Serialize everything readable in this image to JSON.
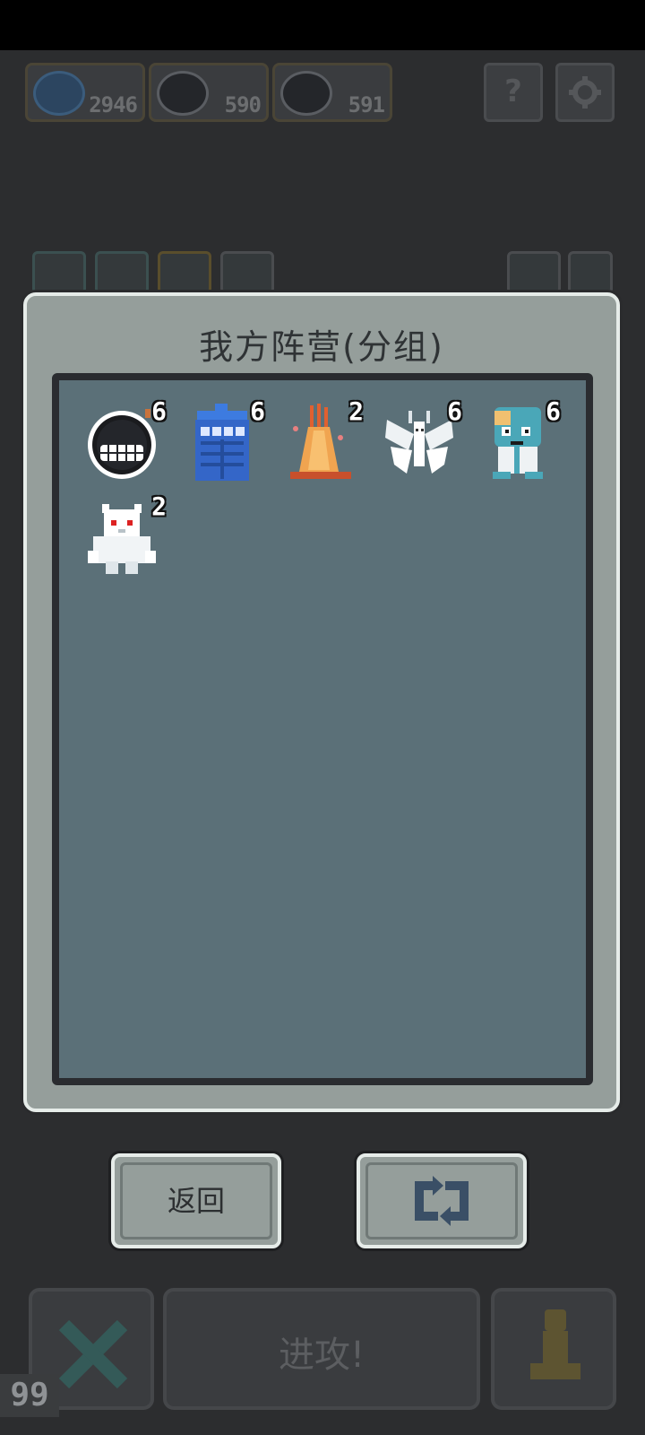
{
  "resources": [
    {
      "icon": "blue-gem-icon",
      "value": "2946"
    },
    {
      "icon": "grinning-bomb-icon",
      "value": "590"
    },
    {
      "icon": "grinning-bomb-icon",
      "value": "591"
    }
  ],
  "top_buttons": {
    "help_label": "?",
    "settings_icon": "gear-icon"
  },
  "dialog": {
    "title": "我方阵营(分组)",
    "units": [
      {
        "name": "grinning-bomb",
        "count": "6"
      },
      {
        "name": "blue-booth",
        "count": "6"
      },
      {
        "name": "flame-tree",
        "count": "2"
      },
      {
        "name": "white-moth",
        "count": "6"
      },
      {
        "name": "teal-frog-creature",
        "count": "6"
      },
      {
        "name": "white-yeti",
        "count": "2"
      }
    ],
    "back_label": "返回",
    "swap_icon": "swap-arrows-icon"
  },
  "bottom_bar": {
    "attack_label": "进攻!"
  },
  "fps": "99",
  "colors": {
    "dialog_bg": "#959e9b",
    "roster_bg": "#5b7078",
    "border_light": "#e6ece9"
  }
}
